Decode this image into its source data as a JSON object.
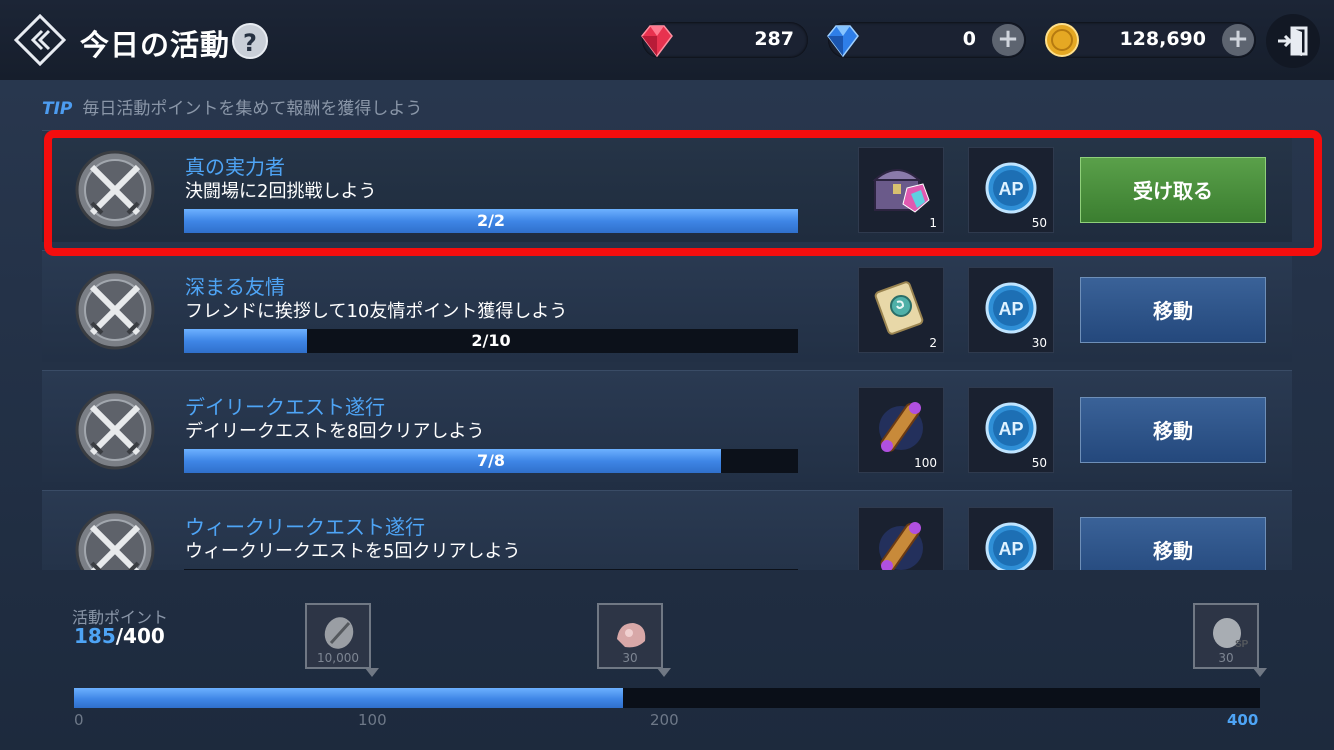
{
  "header": {
    "title": "今日の活動",
    "help": "?",
    "currencies": [
      {
        "name": "ruby",
        "value": "287"
      },
      {
        "name": "sapphire",
        "value": "0",
        "plus": "+"
      },
      {
        "name": "gold",
        "value": "128,690",
        "plus": "+"
      }
    ]
  },
  "tip": {
    "label": "TIP",
    "text": "毎日活動ポイントを集めて報酬を獲得しよう"
  },
  "quests": [
    {
      "title": "真の実力者",
      "desc": "決闘場に2回挑戦しよう",
      "progress_text": "2/2",
      "progress": 1.0,
      "rewards": [
        {
          "icon": "treasure-chest-icon",
          "count": "1"
        },
        {
          "icon": "ap-coin-icon",
          "count": "50"
        }
      ],
      "button": "受け取る"
    },
    {
      "title": "深まる友情",
      "desc": "フレンドに挨拶して10友情ポイント獲得しよう",
      "progress_text": "2/10",
      "progress": 0.2,
      "rewards": [
        {
          "icon": "scroll-icon",
          "count": "2"
        },
        {
          "icon": "ap-coin-icon",
          "count": "30"
        }
      ],
      "button": "移動"
    },
    {
      "title": "デイリークエスト遂行",
      "desc": "デイリークエストを8回クリアしよう",
      "progress_text": "7/8",
      "progress": 0.875,
      "rewards": [
        {
          "icon": "magic-scroll-icon",
          "count": "100"
        },
        {
          "icon": "ap-coin-icon",
          "count": "50"
        }
      ],
      "button": "移動"
    },
    {
      "title": "ウィークリークエスト遂行",
      "desc": "ウィークリークエストを5回クリアしよう",
      "progress_text": "",
      "progress": 0.0,
      "rewards": [
        {
          "icon": "magic-scroll-icon",
          "count": ""
        },
        {
          "icon": "ap-coin-icon",
          "count": ""
        }
      ],
      "button": "移動"
    }
  ],
  "activity": {
    "label": "活動ポイント",
    "current": "185",
    "max": "/400",
    "progress": 0.4625,
    "milestones": [
      {
        "icon": "silver-coin-icon",
        "value": "10,000"
      },
      {
        "icon": "ore-icon",
        "value": "30"
      },
      {
        "icon": "sp-coin-icon",
        "value": "30"
      }
    ],
    "ticks": [
      "0",
      "100",
      "200",
      "400"
    ]
  },
  "colors": {
    "accent": "#4ea4f5",
    "highlight_frame": "#f40d0d",
    "claim_button": "#4a9040",
    "move_button": "#2f5588"
  }
}
